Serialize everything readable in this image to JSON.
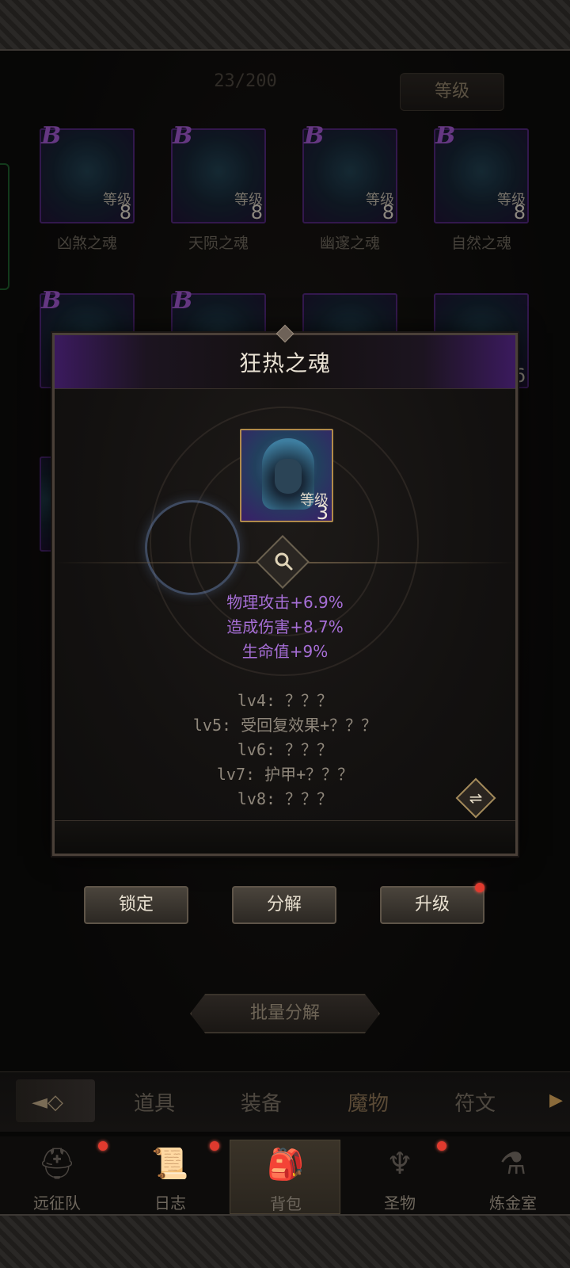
{
  "inventory": {
    "capacity": "23/200",
    "sort_label": "等级"
  },
  "cards": [
    {
      "rank": "B",
      "level_label": "等级",
      "level": "8",
      "name": "凶煞之魂"
    },
    {
      "rank": "B",
      "level_label": "等级",
      "level": "8",
      "name": "天陨之魂"
    },
    {
      "rank": "B",
      "level_label": "等级",
      "level": "8",
      "name": "幽邃之魂"
    },
    {
      "rank": "B",
      "level_label": "等级",
      "level": "8",
      "name": "自然之魂"
    },
    {
      "rank": "B",
      "level_label": "",
      "level": "",
      "name": ""
    },
    {
      "rank": "B",
      "level_label": "",
      "level": "",
      "name": ""
    },
    {
      "rank": "",
      "level_label": "",
      "level": "",
      "name": ""
    },
    {
      "rank": "",
      "level_label": "",
      "level": "6",
      "name": ""
    }
  ],
  "popup": {
    "title": "狂热之魂",
    "level_label": "等级",
    "level": "3",
    "stats": [
      "物理攻击+6.9%",
      "造成伤害+8.7%",
      "生命值+9%"
    ],
    "skills": [
      "lv4: ？？？",
      "lv5: 受回复效果+？？？",
      "lv6: ？？？",
      "lv7: 护甲+？？？",
      "lv8: ？？？"
    ],
    "magnify_icon": "magnify-icon",
    "expand_icon": "expand-icon"
  },
  "actions": {
    "lock": "锁定",
    "decompose": "分解",
    "upgrade": "升级"
  },
  "batch_decompose": "批量分解",
  "category_tabs": [
    "道具",
    "装备",
    "魔物",
    "符文"
  ],
  "active_category": "魔物",
  "bottom_nav": [
    {
      "label": "远征队",
      "icon": "viking-helmet-icon",
      "badge": true
    },
    {
      "label": "日志",
      "icon": "scroll-icon",
      "badge": true
    },
    {
      "label": "背包",
      "icon": "backpack-icon",
      "badge": false
    },
    {
      "label": "圣物",
      "icon": "torch-icon",
      "badge": true
    },
    {
      "label": "炼金室",
      "icon": "alchemy-icon",
      "badge": false
    }
  ],
  "active_nav": "背包",
  "colors": {
    "rank_purple": "#9b55c8",
    "stat_purple": "#a66ed6",
    "badge_red": "#e03a2e",
    "gold_frame": "#b08a4a"
  }
}
